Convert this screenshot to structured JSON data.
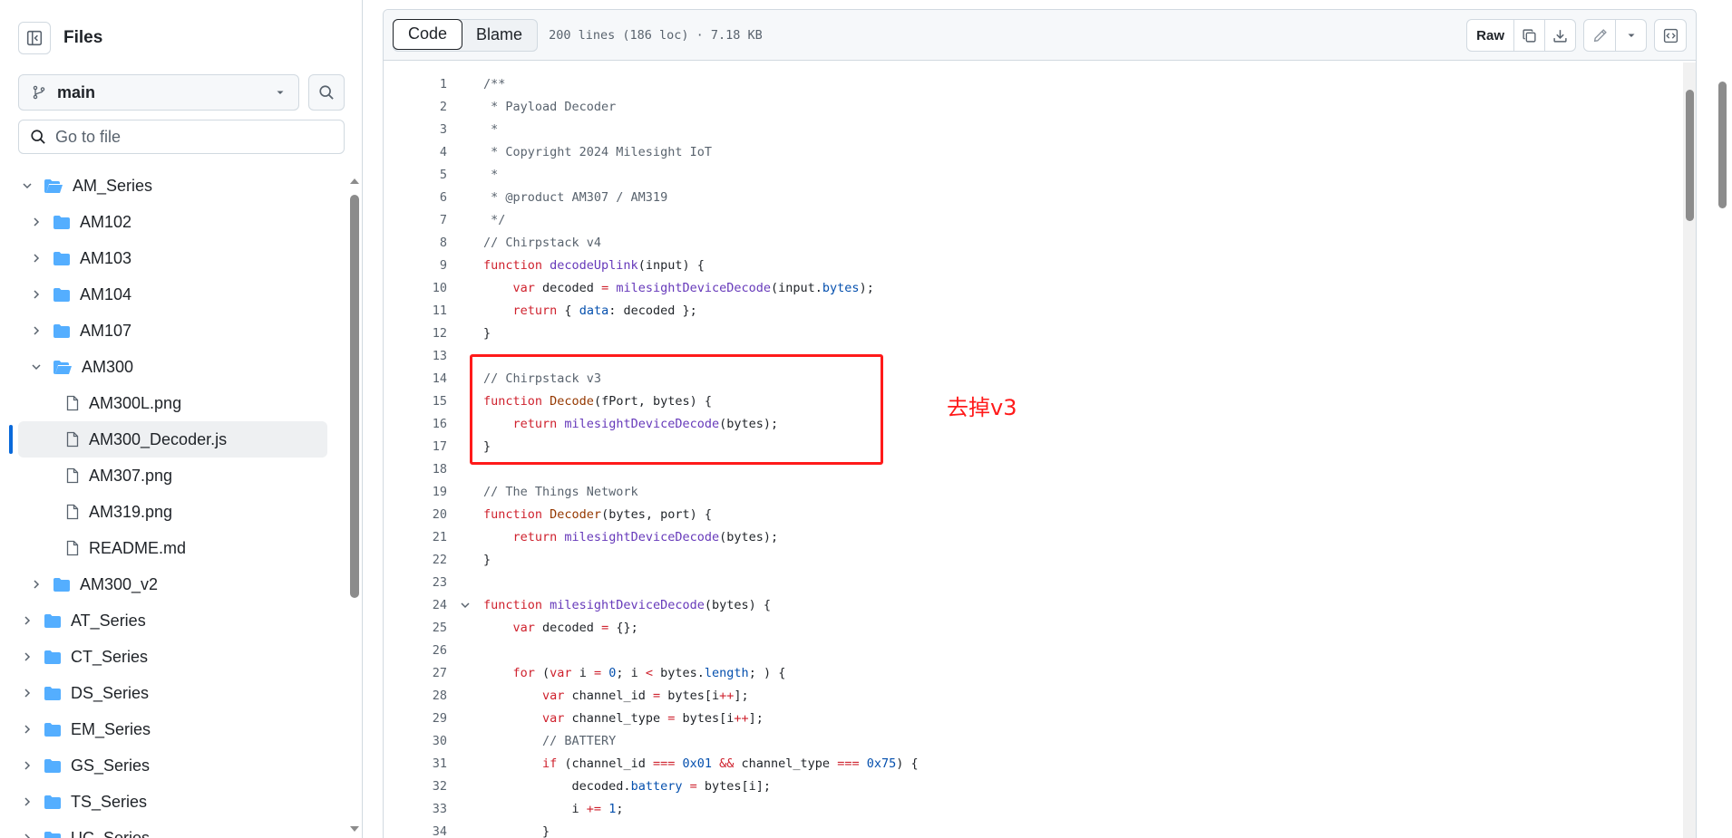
{
  "sidebar": {
    "title": "Files",
    "branch": "main",
    "goto_placeholder": "Go to file",
    "tree": [
      {
        "label": "AM_Series",
        "type": "folder",
        "depth": 0,
        "expanded": true
      },
      {
        "label": "AM102",
        "type": "folder",
        "depth": 1,
        "expanded": false
      },
      {
        "label": "AM103",
        "type": "folder",
        "depth": 1,
        "expanded": false
      },
      {
        "label": "AM104",
        "type": "folder",
        "depth": 1,
        "expanded": false
      },
      {
        "label": "AM107",
        "type": "folder",
        "depth": 1,
        "expanded": false
      },
      {
        "label": "AM300",
        "type": "folder",
        "depth": 1,
        "expanded": true
      },
      {
        "label": "AM300L.png",
        "type": "file",
        "depth": 2
      },
      {
        "label": "AM300_Decoder.js",
        "type": "file",
        "depth": 2,
        "selected": true
      },
      {
        "label": "AM307.png",
        "type": "file",
        "depth": 2
      },
      {
        "label": "AM319.png",
        "type": "file",
        "depth": 2
      },
      {
        "label": "README.md",
        "type": "file",
        "depth": 2
      },
      {
        "label": "AM300_v2",
        "type": "folder",
        "depth": 1,
        "expanded": false
      },
      {
        "label": "AT_Series",
        "type": "folder",
        "depth": 0,
        "expanded": false
      },
      {
        "label": "CT_Series",
        "type": "folder",
        "depth": 0,
        "expanded": false
      },
      {
        "label": "DS_Series",
        "type": "folder",
        "depth": 0,
        "expanded": false
      },
      {
        "label": "EM_Series",
        "type": "folder",
        "depth": 0,
        "expanded": false
      },
      {
        "label": "GS_Series",
        "type": "folder",
        "depth": 0,
        "expanded": false
      },
      {
        "label": "TS_Series",
        "type": "folder",
        "depth": 0,
        "expanded": false
      },
      {
        "label": "UC_Series",
        "type": "folder",
        "depth": 0,
        "expanded": false
      }
    ]
  },
  "toolbar": {
    "code_tab": "Code",
    "blame_tab": "Blame",
    "file_info": "200 lines (186 loc) · 7.18 KB",
    "raw_label": "Raw"
  },
  "code_lines": [
    {
      "n": "1",
      "t": [
        [
          "c",
          "/**"
        ]
      ]
    },
    {
      "n": "2",
      "t": [
        [
          "c",
          " * Payload Decoder"
        ]
      ]
    },
    {
      "n": "3",
      "t": [
        [
          "c",
          " *"
        ]
      ]
    },
    {
      "n": "4",
      "t": [
        [
          "c",
          " * Copyright 2024 Milesight IoT"
        ]
      ]
    },
    {
      "n": "5",
      "t": [
        [
          "c",
          " *"
        ]
      ]
    },
    {
      "n": "6",
      "t": [
        [
          "c",
          " * @product AM307 / AM319"
        ]
      ]
    },
    {
      "n": "7",
      "t": [
        [
          "c",
          " */"
        ]
      ]
    },
    {
      "n": "8",
      "t": [
        [
          "c",
          "// Chirpstack v4"
        ]
      ]
    },
    {
      "n": "9",
      "t": [
        [
          "k",
          "function "
        ],
        [
          "f",
          "decodeUplink"
        ],
        [
          "",
          "(input) {"
        ]
      ]
    },
    {
      "n": "10",
      "t": [
        [
          "",
          "    "
        ],
        [
          "k",
          "var "
        ],
        [
          "",
          "decoded "
        ],
        [
          "k",
          "= "
        ],
        [
          "f",
          "milesightDeviceDecode"
        ],
        [
          "",
          "(input."
        ],
        [
          "p",
          "bytes"
        ],
        [
          "",
          ");"
        ]
      ]
    },
    {
      "n": "11",
      "t": [
        [
          "",
          "    "
        ],
        [
          "k",
          "return "
        ],
        [
          "",
          "{ "
        ],
        [
          "p",
          "data"
        ],
        [
          "",
          ": decoded };"
        ]
      ]
    },
    {
      "n": "12",
      "t": [
        [
          "",
          "}"
        ]
      ]
    },
    {
      "n": "13",
      "t": [
        [
          "",
          ""
        ]
      ]
    },
    {
      "n": "14",
      "t": [
        [
          "c",
          "// Chirpstack v3"
        ]
      ]
    },
    {
      "n": "15",
      "t": [
        [
          "k",
          "function "
        ],
        [
          "e",
          "Decode"
        ],
        [
          "",
          "(fPort, bytes) {"
        ]
      ]
    },
    {
      "n": "16",
      "t": [
        [
          "",
          "    "
        ],
        [
          "k",
          "return "
        ],
        [
          "f",
          "milesightDeviceDecode"
        ],
        [
          "",
          "(bytes);"
        ]
      ]
    },
    {
      "n": "17",
      "t": [
        [
          "",
          "}"
        ]
      ]
    },
    {
      "n": "18",
      "t": [
        [
          "",
          ""
        ]
      ]
    },
    {
      "n": "19",
      "t": [
        [
          "c",
          "// The Things Network"
        ]
      ]
    },
    {
      "n": "20",
      "t": [
        [
          "k",
          "function "
        ],
        [
          "e",
          "Decoder"
        ],
        [
          "",
          "(bytes, port) {"
        ]
      ]
    },
    {
      "n": "21",
      "t": [
        [
          "",
          "    "
        ],
        [
          "k",
          "return "
        ],
        [
          "f",
          "milesightDeviceDecode"
        ],
        [
          "",
          "(bytes);"
        ]
      ]
    },
    {
      "n": "22",
      "t": [
        [
          "",
          "}"
        ]
      ]
    },
    {
      "n": "23",
      "t": [
        [
          "",
          ""
        ]
      ]
    },
    {
      "n": "24",
      "fold": true,
      "t": [
        [
          "k",
          "function "
        ],
        [
          "f",
          "milesightDeviceDecode"
        ],
        [
          "",
          "(bytes) {"
        ]
      ]
    },
    {
      "n": "25",
      "t": [
        [
          "",
          "    "
        ],
        [
          "k",
          "var "
        ],
        [
          "",
          "decoded "
        ],
        [
          "k",
          "= "
        ],
        [
          "",
          "{};"
        ]
      ]
    },
    {
      "n": "26",
      "t": [
        [
          "",
          ""
        ]
      ]
    },
    {
      "n": "27",
      "t": [
        [
          "",
          "    "
        ],
        [
          "k",
          "for "
        ],
        [
          "",
          "("
        ],
        [
          "k",
          "var "
        ],
        [
          "",
          "i "
        ],
        [
          "k",
          "= "
        ],
        [
          "p",
          "0"
        ],
        [
          "",
          "; i "
        ],
        [
          "k",
          "< "
        ],
        [
          "",
          "bytes."
        ],
        [
          "p",
          "length"
        ],
        [
          "",
          "; ) {"
        ]
      ]
    },
    {
      "n": "28",
      "t": [
        [
          "",
          "        "
        ],
        [
          "k",
          "var "
        ],
        [
          "",
          "channel_id "
        ],
        [
          "k",
          "= "
        ],
        [
          "",
          "bytes[i"
        ],
        [
          "k",
          "++"
        ],
        [
          "",
          "];"
        ]
      ]
    },
    {
      "n": "29",
      "t": [
        [
          "",
          "        "
        ],
        [
          "k",
          "var "
        ],
        [
          "",
          "channel_type "
        ],
        [
          "k",
          "= "
        ],
        [
          "",
          "bytes[i"
        ],
        [
          "k",
          "++"
        ],
        [
          "",
          "];"
        ]
      ]
    },
    {
      "n": "30",
      "t": [
        [
          "",
          "        "
        ],
        [
          "c",
          "// BATTERY"
        ]
      ]
    },
    {
      "n": "31",
      "t": [
        [
          "",
          "        "
        ],
        [
          "k",
          "if "
        ],
        [
          "",
          "(channel_id "
        ],
        [
          "k",
          "=== "
        ],
        [
          "p",
          "0x01"
        ],
        [
          "",
          " "
        ],
        [
          "k",
          "&& "
        ],
        [
          "",
          "channel_type "
        ],
        [
          "k",
          "=== "
        ],
        [
          "p",
          "0x75"
        ],
        [
          "",
          ") {"
        ]
      ]
    },
    {
      "n": "32",
      "t": [
        [
          "",
          "            decoded."
        ],
        [
          "p",
          "battery"
        ],
        [
          "",
          " "
        ],
        [
          "k",
          "= "
        ],
        [
          "",
          "bytes[i];"
        ]
      ]
    },
    {
      "n": "33",
      "t": [
        [
          "",
          "            i "
        ],
        [
          "k",
          "+= "
        ],
        [
          "p",
          "1"
        ],
        [
          "",
          ";"
        ]
      ]
    },
    {
      "n": "34",
      "t": [
        [
          "",
          "        }"
        ]
      ]
    }
  ],
  "annotation": {
    "note": "去掉v3",
    "color": "#ff1a1a"
  },
  "colors": {
    "accent": "#0969da",
    "folder": "#54aeff",
    "keyword": "#cf222e",
    "function": "#6639ba",
    "entity": "#953800",
    "constant": "#0550ae",
    "comment": "#59636e"
  }
}
